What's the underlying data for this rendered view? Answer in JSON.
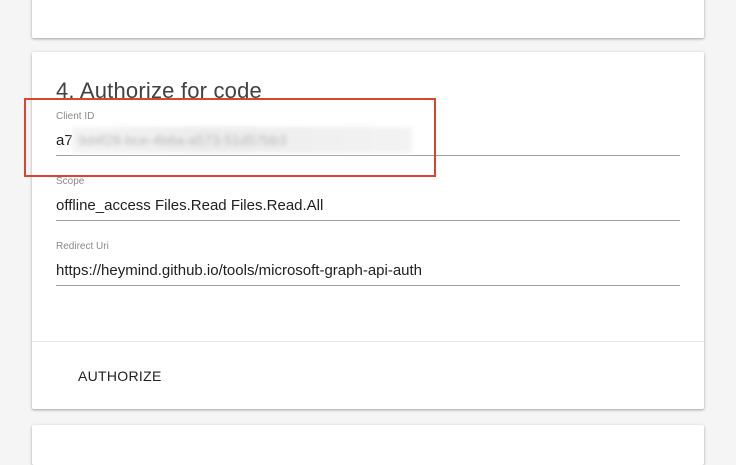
{
  "auth_section": {
    "title": "4. Authorize for code",
    "client_id": {
      "label": "Client ID",
      "value": "a7",
      "blurred_placeholder": "9d4f28-bce-4b6a-a573-51d57bb3"
    },
    "scope": {
      "label": "Scope",
      "value": "offline_access Files.Read Files.Read.All"
    },
    "redirect_uri": {
      "label": "Redirect Uri",
      "value": "https://heymind.github.io/tools/microsoft-graph-api-auth"
    },
    "authorize_button_label": "AUTHORIZE"
  },
  "colors": {
    "highlight": "#d8462c",
    "page_background": "#f5f5f5",
    "card_background": "#ffffff"
  }
}
